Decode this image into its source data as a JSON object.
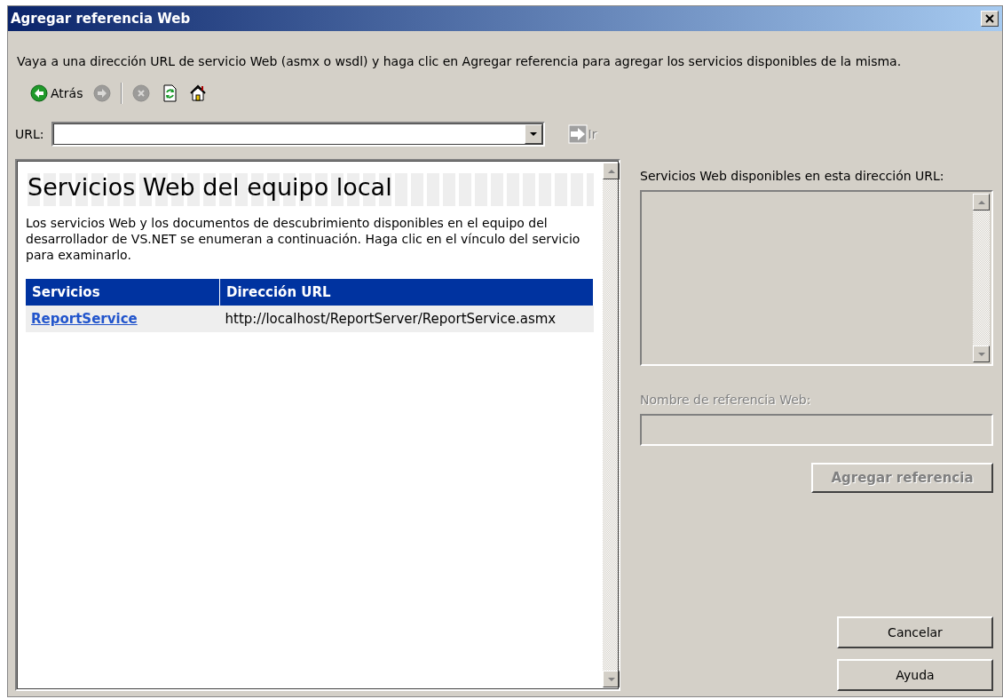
{
  "window": {
    "title": "Agregar referencia Web"
  },
  "instructions": "Vaya a una dirección URL de servicio Web (asmx o wsdl) y haga clic en Agregar referencia para agregar los servicios disponibles de la misma.",
  "toolbar": [
    {
      "kind": "back",
      "label": "Atrás",
      "disabled": false
    },
    {
      "kind": "forward",
      "disabled": true
    },
    {
      "kind": "separator"
    },
    {
      "kind": "stop",
      "disabled": true
    },
    {
      "kind": "refresh",
      "disabled": false
    },
    {
      "kind": "home",
      "disabled": false
    }
  ],
  "url_bar": {
    "label": "URL:",
    "go_label": "Ir",
    "go_disabled": true
  },
  "browser": {
    "heading": "Servicios Web del equipo local",
    "description": "Los servicios Web y los documentos de descubrimiento disponibles en el equipo del desarrollador de VS.NET se enumeran a continuación. Haga clic en el vínculo del servicio para examinarlo.",
    "table": {
      "columns": [
        "Servicios",
        "Dirección URL"
      ],
      "rows": [
        {
          "service": "ReportService",
          "url": "http://localhost/ReportServer/ReportService.asmx"
        }
      ]
    }
  },
  "available": {
    "label": "Servicios Web disponibles en esta dirección URL:"
  },
  "reference_name": {
    "label": "Nombre de referencia Web:",
    "disabled": true
  },
  "add_button": {
    "label": "Agregar referencia",
    "disabled": true
  },
  "buttons": [
    {
      "label": "Cancelar"
    },
    {
      "label": "Ayuda"
    }
  ]
}
